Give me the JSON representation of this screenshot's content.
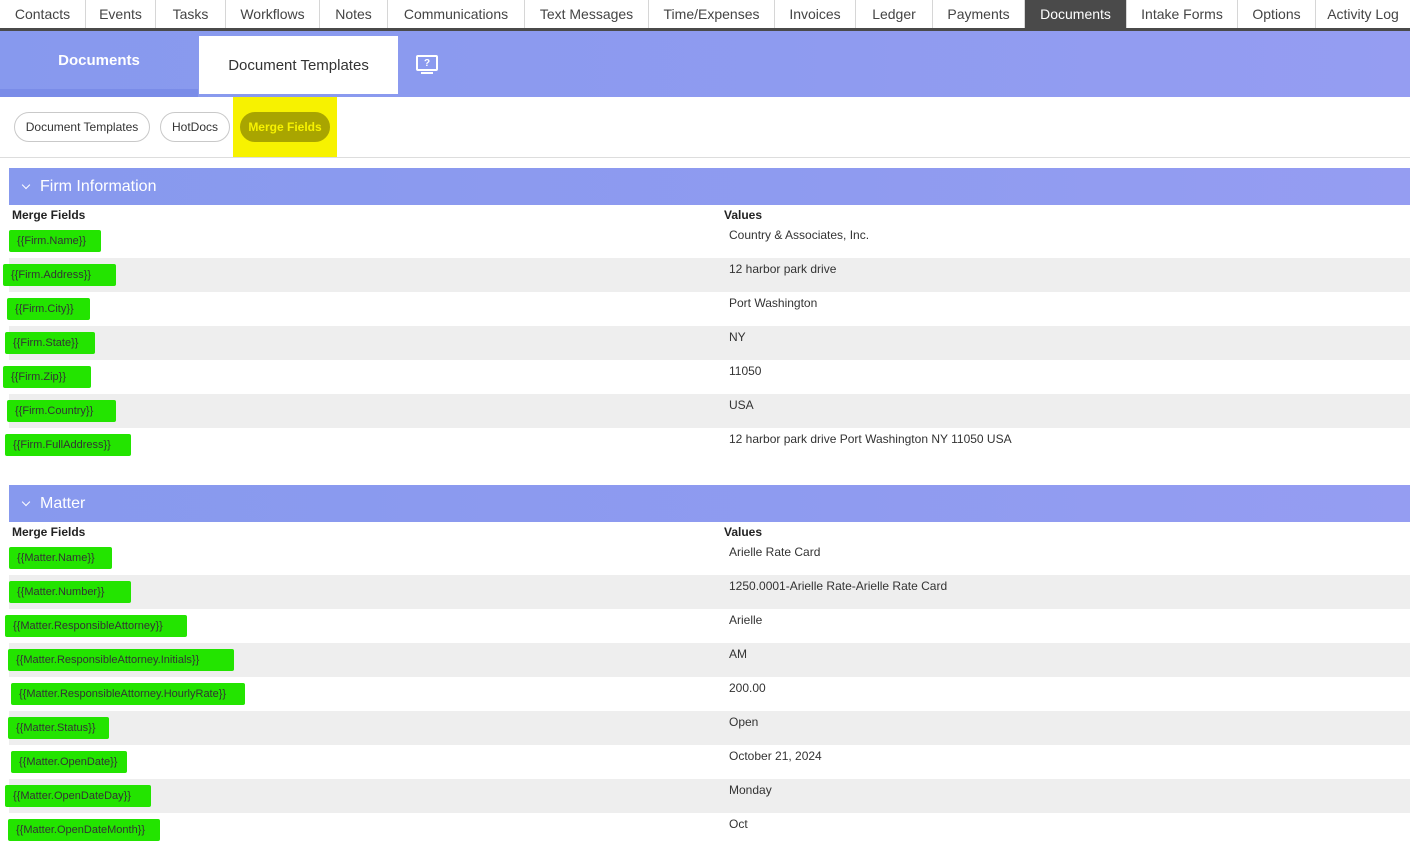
{
  "nav_tabs": [
    {
      "label": "Contacts",
      "active": false
    },
    {
      "label": "Events",
      "active": false
    },
    {
      "label": "Tasks",
      "active": false
    },
    {
      "label": "Workflows",
      "active": false
    },
    {
      "label": "Notes",
      "active": false
    },
    {
      "label": "Communications",
      "active": false
    },
    {
      "label": "Text Messages",
      "active": false
    },
    {
      "label": "Time/Expenses",
      "active": false
    },
    {
      "label": "Invoices",
      "active": false
    },
    {
      "label": "Ledger",
      "active": false
    },
    {
      "label": "Payments",
      "active": false
    },
    {
      "label": "Documents",
      "active": true
    },
    {
      "label": "Intake Forms",
      "active": false
    },
    {
      "label": "Options",
      "active": false
    },
    {
      "label": "Activity Log",
      "active": false
    }
  ],
  "band": {
    "documents_label": "Documents",
    "active_subtab": "Document Templates",
    "help_icon": "?"
  },
  "pills": {
    "document_templates": "Document Templates",
    "hotdocs": "HotDocs",
    "merge_fields": "Merge Fields"
  },
  "columns": {
    "fields": "Merge Fields",
    "values": "Values"
  },
  "sections": [
    {
      "title": "Firm Information",
      "rows": [
        {
          "field": "{{Firm.Name}}",
          "value": "Country & Associates, Inc."
        },
        {
          "field": "{{Firm.Address}}",
          "value": "12 harbor park drive"
        },
        {
          "field": "{{Firm.City}}",
          "value": "Port Washington"
        },
        {
          "field": "{{Firm.State}}",
          "value": "NY"
        },
        {
          "field": "{{Firm.Zip}}",
          "value": "11050"
        },
        {
          "field": "{{Firm.Country}}",
          "value": "USA"
        },
        {
          "field": "{{Firm.FullAddress}}",
          "value": "12 harbor park drive Port Washington NY 11050 USA"
        }
      ]
    },
    {
      "title": "Matter",
      "rows": [
        {
          "field": "{{Matter.Name}}",
          "value": "Arielle Rate Card"
        },
        {
          "field": "{{Matter.Number}}",
          "value": "1250.0001-Arielle Rate-Arielle Rate Card"
        },
        {
          "field": "{{Matter.ResponsibleAttorney}}",
          "value": "Arielle"
        },
        {
          "field": "{{Matter.ResponsibleAttorney.Initials}}",
          "value": "AM"
        },
        {
          "field": "{{Matter.ResponsibleAttorney.HourlyRate}}",
          "value": "200.00"
        },
        {
          "field": "{{Matter.Status}}",
          "value": "Open"
        },
        {
          "field": "{{Matter.OpenDate}}",
          "value": "October 21, 2024"
        },
        {
          "field": "{{Matter.OpenDateDay}}",
          "value": "Monday"
        },
        {
          "field": "{{Matter.OpenDateMonth}}",
          "value": "Oct"
        }
      ]
    }
  ],
  "colors": {
    "accent_purple": "#8f9bf0",
    "field_highlight": "#23e400",
    "merge_pill_highlight": "#f7f200",
    "active_tab": "#4a4a4a"
  }
}
